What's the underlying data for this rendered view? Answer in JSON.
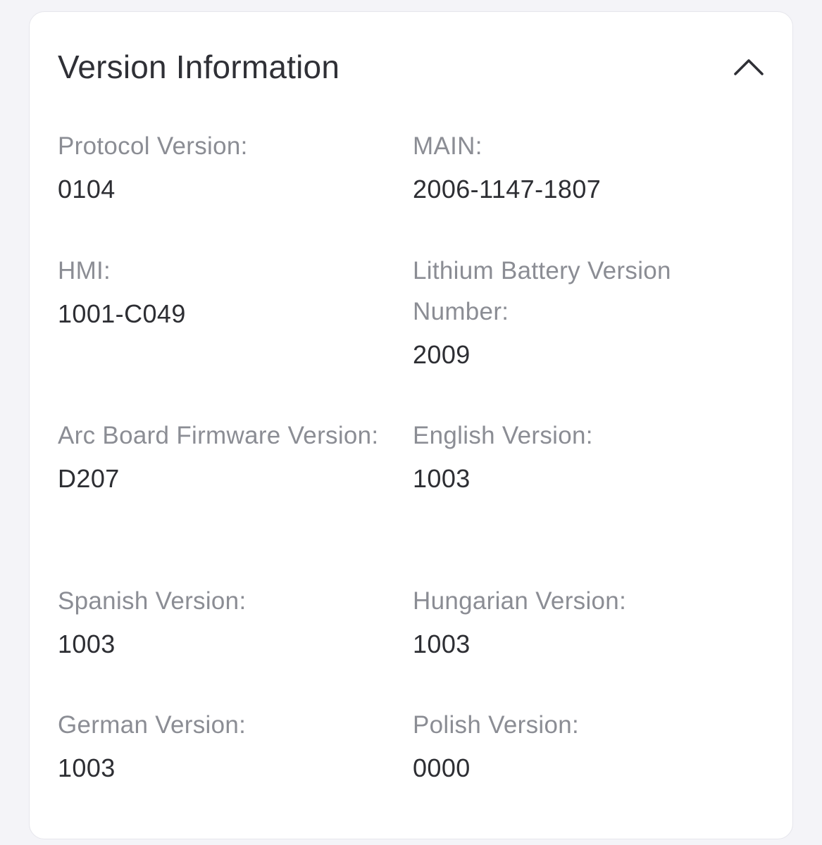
{
  "header": {
    "title": "Version Information",
    "collapse_icon": "chevron-up-icon"
  },
  "fields": [
    {
      "label": "Protocol Version:",
      "value": "0104"
    },
    {
      "label": "MAIN:",
      "value": "2006-1147-1807"
    },
    {
      "label": "HMI:",
      "value": "1001-C049"
    },
    {
      "label": "Lithium Battery Version Number:",
      "value": "2009"
    },
    {
      "label": "Arc Board Firmware Version:",
      "value": "D207"
    },
    {
      "label": "English Version:",
      "value": "1003"
    },
    {
      "label": "Spanish Version:",
      "value": "1003"
    },
    {
      "label": "Hungarian Version:",
      "value": "1003"
    },
    {
      "label": "German Version:",
      "value": "1003"
    },
    {
      "label": "Polish Version:",
      "value": "0000"
    }
  ],
  "colors": {
    "background": "#f4f4f8",
    "card": "#ffffff",
    "title": "#2f3036",
    "label": "#8b8d94",
    "value": "#2d2e33"
  }
}
